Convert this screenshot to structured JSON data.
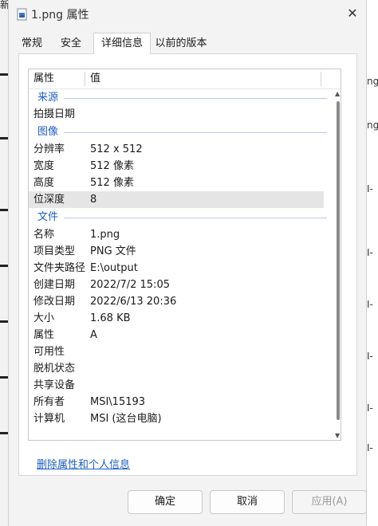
{
  "background": {
    "top_text": "新",
    "right_marks": [
      "ng",
      "ng",
      "I-",
      "I-",
      "I-",
      "I-",
      "I-",
      "I-"
    ]
  },
  "window": {
    "title": "1.png 属性",
    "close_glyph": "✕"
  },
  "tabs": [
    {
      "label": "常规",
      "active": false
    },
    {
      "label": "安全",
      "active": false
    },
    {
      "label": "详细信息",
      "active": true
    },
    {
      "label": "以前的版本",
      "active": false
    }
  ],
  "details": {
    "columns": {
      "property": "属性",
      "value": "值"
    },
    "groups": {
      "source": "来源",
      "image": "图像",
      "file": "文件"
    },
    "source_rows": [
      {
        "key": "拍摄日期",
        "value": ""
      }
    ],
    "image_rows": [
      {
        "key": "分辨率",
        "value": "512 x 512"
      },
      {
        "key": "宽度",
        "value": "512 像素"
      },
      {
        "key": "高度",
        "value": "512 像素"
      },
      {
        "key": "位深度",
        "value": "8"
      }
    ],
    "file_rows": [
      {
        "key": "名称",
        "value": "1.png"
      },
      {
        "key": "项目类型",
        "value": "PNG 文件"
      },
      {
        "key": "文件夹路径",
        "value": "E:\\output"
      },
      {
        "key": "创建日期",
        "value": "2022/7/2 15:05"
      },
      {
        "key": "修改日期",
        "value": "2022/6/13 20:36"
      },
      {
        "key": "大小",
        "value": "1.68 KB"
      },
      {
        "key": "属性",
        "value": "A"
      },
      {
        "key": "可用性",
        "value": ""
      },
      {
        "key": "脱机状态",
        "value": ""
      },
      {
        "key": "共享设备",
        "value": ""
      },
      {
        "key": "所有者",
        "value": "MSI\\15193"
      },
      {
        "key": "计算机",
        "value": "MSI (这台电脑)"
      }
    ],
    "selected_key": "位深度"
  },
  "remove_link": "删除属性和个人信息",
  "buttons": {
    "ok": "确定",
    "cancel": "取消",
    "apply": "应用(A)"
  },
  "colors": {
    "accent": "#1f5fbf",
    "dialog_bg": "#f3f3f3"
  }
}
